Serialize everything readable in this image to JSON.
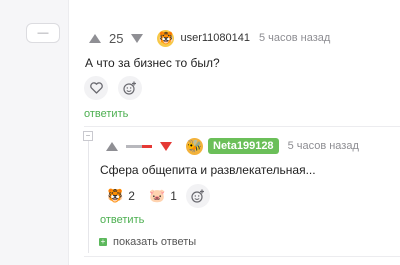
{
  "sidebar": {
    "collapse_label": "—"
  },
  "comment1": {
    "score": "25",
    "avatar_emoji": "🐯",
    "username": "user11080141",
    "time": "5 часов назад",
    "text": "А что за бизнес то был?",
    "reply_label": "ответить"
  },
  "comment2": {
    "avatar_emoji": "🐝",
    "username": "Neta199128",
    "time": "5 часов назад",
    "text": "Сфера общепита и развлекательная...",
    "reactions": [
      {
        "emoji": "🐯",
        "count": "2"
      },
      {
        "emoji": "🐷",
        "count": "1"
      }
    ],
    "reply_label": "ответить",
    "show_replies_label": "показать ответы"
  },
  "colors": {
    "accent_green": "#4caf50",
    "badge_green": "#6bbf59",
    "downvote_red": "#e53935"
  },
  "icons": {
    "like": "heart-icon",
    "add_reaction": "emoji-add-icon",
    "upvote": "triangle-up-icon",
    "downvote": "triangle-down-icon"
  }
}
